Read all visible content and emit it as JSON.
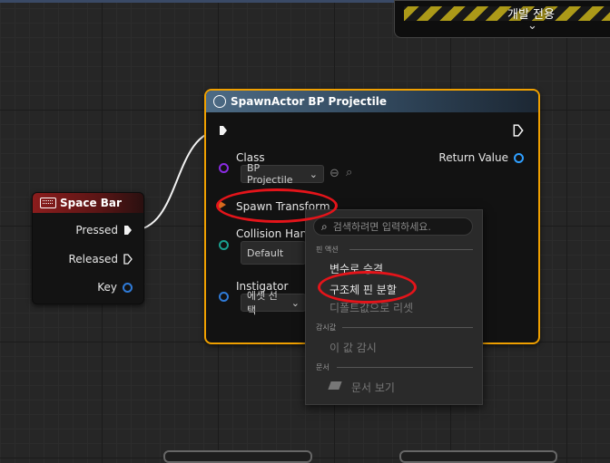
{
  "dev_banner": {
    "label": "개발 전용"
  },
  "space_bar_node": {
    "title": "Space Bar",
    "pins": {
      "pressed": "Pressed",
      "released": "Released",
      "key": "Key"
    }
  },
  "spawn_node": {
    "title": "SpawnActor BP Projectile",
    "class_label": "Class",
    "class_value": "BP Projectile",
    "spawn_transform_label": "Spawn Transform",
    "collision_label": "Collision Handl",
    "collision_value": "Default",
    "instigator_label": "Instigator",
    "instigator_value": "에셋 선택",
    "return_value_label": "Return Value"
  },
  "context_menu": {
    "search_placeholder": "검색하려면 입력하세요.",
    "sections": {
      "pin_actions": "핀 액션",
      "watch": "감시값",
      "docs": "문서"
    },
    "items": {
      "promote_to_variable": "변수로 승격",
      "split_struct_pin": "구조체 핀 분할",
      "reset_to_default": "디폴트값으로 리셋",
      "watch_value": "이 값 감시",
      "view_docs": "문서 보기"
    }
  },
  "colors": {
    "selected_border": "#f0a000",
    "annotation_red": "#e4141a",
    "object_pin": "#8a2be2",
    "struct_pin": "#d66a1e",
    "enum_pin": "#1aa090",
    "key_pin": "#2f7bd8"
  }
}
